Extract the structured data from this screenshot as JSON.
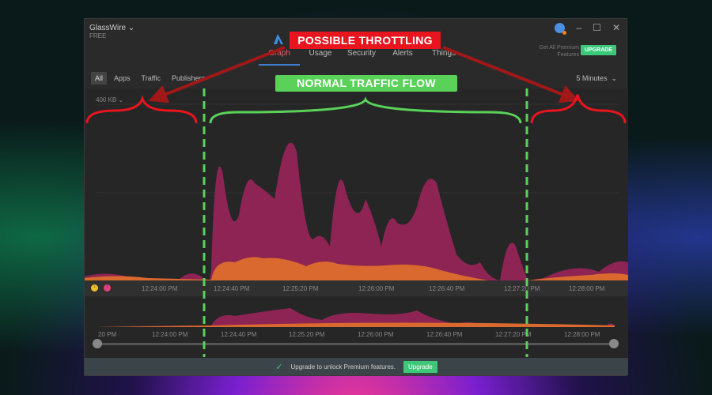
{
  "app": {
    "title": "GlassWire",
    "plan": "FREE"
  },
  "nav": {
    "tabs": [
      {
        "label": "Graph",
        "active": true
      },
      {
        "label": "Usage"
      },
      {
        "label": "Security"
      },
      {
        "label": "Alerts"
      },
      {
        "label": "Things"
      }
    ]
  },
  "header": {
    "premium_text_1": "Get All Premium",
    "premium_text_2": "Features",
    "upgrade_label": "UPGRADE"
  },
  "filters": {
    "items": [
      "All",
      "Apps",
      "Traffic",
      "Publishers"
    ],
    "active": "All",
    "range": "5 Minutes"
  },
  "graph": {
    "y_label": "400 KB",
    "time_labels": [
      "12:24:00 PM",
      "12:24:40 PM",
      "12:25:20 PM",
      "12:26:00 PM",
      "12:26:40 PM",
      "12:27:20 PM",
      "12:28:00 PM"
    ],
    "legend_icons": [
      "download-icon",
      "upload-icon"
    ],
    "colors": {
      "upload": "#a0285a",
      "download": "#e07030"
    }
  },
  "mini": {
    "time_labels": [
      "20 PM",
      "12:24:00 PM",
      "12:24:40 PM",
      "12:25:20 PM",
      "12:26:00 PM",
      "12:26:40 PM",
      "12:27:20 PM",
      "12:28:00 PM"
    ]
  },
  "footer": {
    "text": "Upgrade to unlock Premium features.",
    "button": "Upgrade"
  },
  "annotations": {
    "throttling": "POSSIBLE THROTTLING",
    "normal": "NORMAL TRAFFIC FLOW",
    "colors": {
      "red": "#e8141e",
      "green": "#5ad25a"
    }
  }
}
